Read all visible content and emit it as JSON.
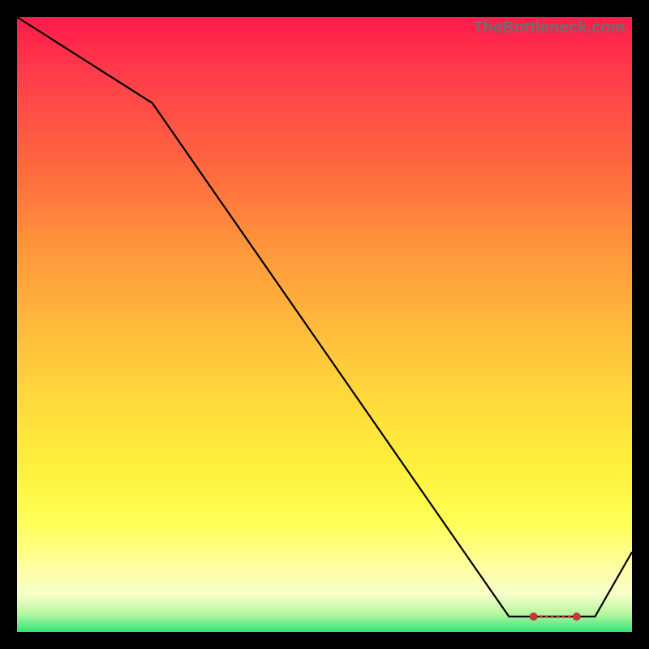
{
  "watermark": "TheBottleneck.com",
  "colors": {
    "background_frame": "#000000",
    "gradient_top": "#ff1a4a",
    "gradient_bottom": "#31e57a",
    "line": "#000000",
    "marker": "#c33a3a"
  },
  "chart_data": {
    "type": "line",
    "title": "",
    "xlabel": "",
    "ylabel": "",
    "x_range": [
      0,
      100
    ],
    "y_range": [
      0,
      100
    ],
    "grid": false,
    "legend": "none",
    "series": [
      {
        "name": "curve",
        "x": [
          0,
          22,
          80,
          83,
          94,
          100
        ],
        "values": [
          100,
          86,
          2.5,
          2.5,
          2.5,
          13
        ]
      }
    ],
    "markers": {
      "style": "dashed-segment-with-end-dots",
      "color": "#c33a3a",
      "points": [
        {
          "x": 84,
          "y": 2.5
        },
        {
          "x": 91,
          "y": 2.5
        }
      ]
    },
    "notes": "Axes have no tick labels; y corresponds to color gradient (red high → green low). Values estimated from pixel positions."
  }
}
